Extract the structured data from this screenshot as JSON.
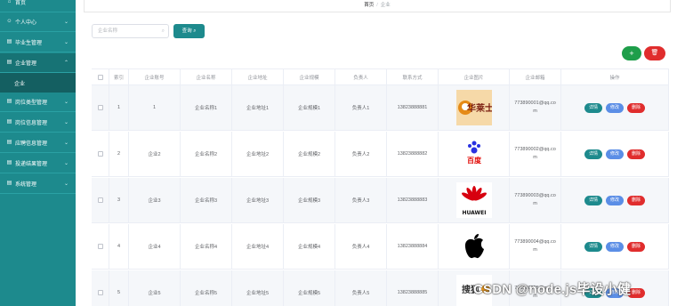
{
  "sidebar": {
    "items": [
      {
        "label": "首页",
        "icon": "home-icon"
      },
      {
        "label": "个人中心",
        "icon": "user-icon"
      },
      {
        "label": "毕业生管理",
        "icon": "folder-icon"
      },
      {
        "label": "企业管理",
        "icon": "folder-icon"
      },
      {
        "label": "岗位类型管理",
        "icon": "folder-icon"
      },
      {
        "label": "岗位信息管理",
        "icon": "folder-icon"
      },
      {
        "label": "应聘信息管理",
        "icon": "folder-icon"
      },
      {
        "label": "投递结果管理",
        "icon": "folder-icon"
      },
      {
        "label": "系统管理",
        "icon": "folder-icon"
      }
    ],
    "sub_item": "企业"
  },
  "breadcrumb": {
    "home": "首页",
    "separator": "/",
    "current": "企业"
  },
  "search": {
    "placeholder": "企业名称",
    "button_label": "查询"
  },
  "toolbar": {
    "add_label": "+",
    "delete_label": "🗑"
  },
  "table": {
    "headers": [
      "",
      "索引",
      "企业账号",
      "企业名称",
      "企业地址",
      "企业规模",
      "负责人",
      "联系方式",
      "企业图片",
      "企业邮箱",
      "操作"
    ],
    "rows": [
      {
        "index": "1",
        "account": "1",
        "name": "企业名称1",
        "address": "企业地址1",
        "scale": "企业规模1",
        "leader": "负责人1",
        "phone": "13823888881",
        "logo": "华莱士",
        "email": "773890001@qq.com"
      },
      {
        "index": "2",
        "account": "企业2",
        "name": "企业名称2",
        "address": "企业地址2",
        "scale": "企业规模2",
        "leader": "负责人2",
        "phone": "13823888882",
        "logo": "百度",
        "email": "773890002@qq.com"
      },
      {
        "index": "3",
        "account": "企业3",
        "name": "企业名称3",
        "address": "企业地址3",
        "scale": "企业规模3",
        "leader": "负责人3",
        "phone": "13823888883",
        "logo": "HUAWEI",
        "email": "773890003@qq.com"
      },
      {
        "index": "4",
        "account": "企业4",
        "name": "企业名称4",
        "address": "企业地址4",
        "scale": "企业规模4",
        "leader": "负责人4",
        "phone": "13823888884",
        "logo": "Apple",
        "email": "773890004@qq.com"
      },
      {
        "index": "5",
        "account": "企业5",
        "name": "企业名称5",
        "address": "企业地址5",
        "scale": "企业规模5",
        "leader": "负责人5",
        "phone": "13823888885",
        "logo": "搜狐",
        "email": "773890005@qq.com"
      }
    ],
    "actions": {
      "detail": "详情",
      "edit": "修改",
      "delete": "删除"
    }
  },
  "watermark": "CSDN @node.js毕设小健",
  "colors": {
    "sidebar": "#1d8a8d",
    "primary": "#1d8a8d",
    "success": "#1e9e4a",
    "danger": "#e02d2d",
    "edit": "#5b8ee6"
  }
}
